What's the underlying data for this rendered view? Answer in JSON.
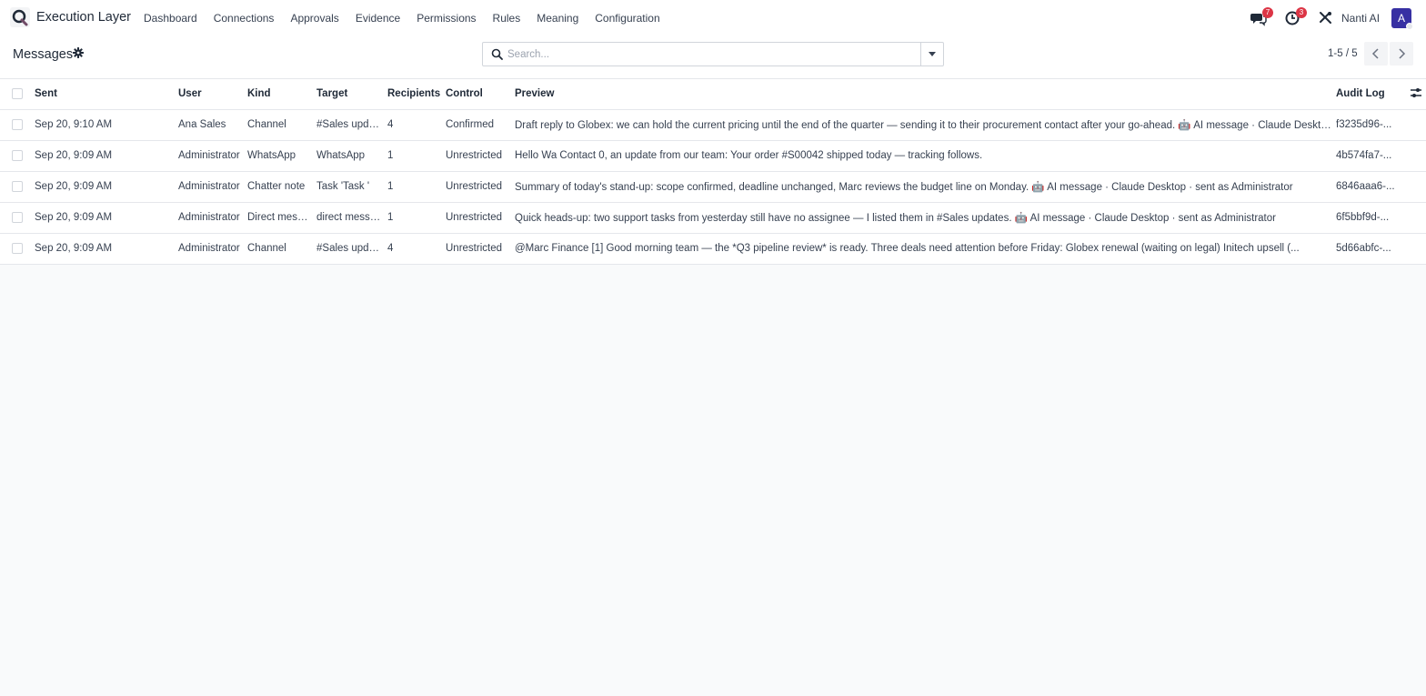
{
  "app": {
    "title": "Execution Layer"
  },
  "menu": [
    "Dashboard",
    "Connections",
    "Approvals",
    "Evidence",
    "Permissions",
    "Rules",
    "Meaning",
    "Configuration"
  ],
  "systray": {
    "messages_badge": "7",
    "activity_badge": "3",
    "company": "Nanti AI",
    "avatar_letter": "A"
  },
  "control": {
    "title": "Messages",
    "search_placeholder": "Search...",
    "pager": "1-5 / 5"
  },
  "table": {
    "columns": [
      "Sent",
      "User",
      "Kind",
      "Target",
      "Recipients",
      "Control",
      "Preview",
      "Audit Log"
    ],
    "rows": [
      {
        "sent": "Sep 20, 9:10 AM",
        "user": "Ana Sales",
        "kind": "Channel",
        "target": "#Sales updates",
        "recipients": "4",
        "control": "Confirmed",
        "preview": "Draft reply to Globex: we can hold the current pricing until the end of the quarter — sending it to their procurement contact after your go-ahead. 🤖 AI message · Claude Desktop · sent as Ana Sales",
        "audit": "f3235d96-..."
      },
      {
        "sent": "Sep 20, 9:09 AM",
        "user": "Administrator",
        "kind": "WhatsApp",
        "target": "WhatsApp",
        "recipients": "1",
        "control": "Unrestricted",
        "preview": "Hello Wa Contact 0, an update from our team: Your order #S00042 shipped today — tracking follows.",
        "audit": "4b574fa7-..."
      },
      {
        "sent": "Sep 20, 9:09 AM",
        "user": "Administrator",
        "kind": "Chatter note",
        "target": "Task 'Task '",
        "recipients": "1",
        "control": "Unrestricted",
        "preview": "Summary of today's stand-up: scope confirmed, deadline unchanged, Marc reviews the budget line on Monday. 🤖 AI message · Claude Desktop · sent as Administrator",
        "audit": "6846aaa6-..."
      },
      {
        "sent": "Sep 20, 9:09 AM",
        "user": "Administrator",
        "kind": "Direct message",
        "target": "direct message",
        "recipients": "1",
        "control": "Unrestricted",
        "preview": "Quick heads-up: two support tasks from yesterday still have no assignee — I listed them in #Sales updates. 🤖 AI message · Claude Desktop · sent as Administrator",
        "audit": "6f5bbf9d-..."
      },
      {
        "sent": "Sep 20, 9:09 AM",
        "user": "Administrator",
        "kind": "Channel",
        "target": "#Sales updates",
        "recipients": "4",
        "control": "Unrestricted",
        "preview": "@Marc Finance [1] Good morning team — the *Q3 pipeline review* is ready. Three deals need attention before Friday: Globex renewal (waiting on legal) Initech upsell (...",
        "audit": "5d66abfc-..."
      }
    ]
  },
  "colors": {
    "badge": "#dc3545",
    "avatar": "#3730a3",
    "accent": "#714b67"
  }
}
